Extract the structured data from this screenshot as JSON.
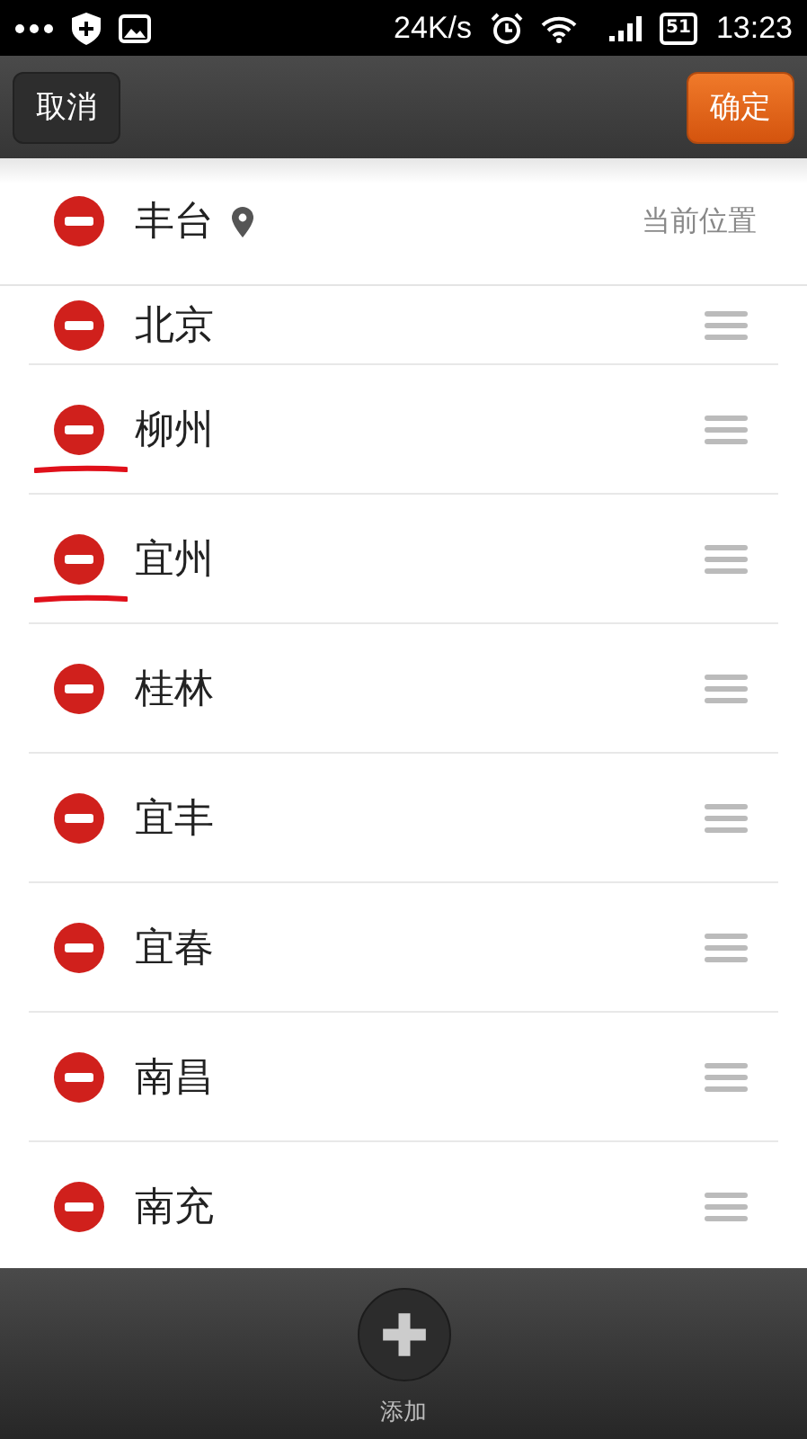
{
  "status_bar": {
    "speed": "24K/s",
    "battery": "51",
    "time": "13:23"
  },
  "header": {
    "cancel": "取消",
    "confirm": "确定"
  },
  "current": {
    "city": "丰台",
    "note": "当前位置"
  },
  "cities": [
    {
      "name": "北京",
      "underlined": false
    },
    {
      "name": "柳州",
      "underlined": true
    },
    {
      "name": "宜州",
      "underlined": true
    },
    {
      "name": "桂林",
      "underlined": false
    },
    {
      "name": "宜丰",
      "underlined": false
    },
    {
      "name": "宜春",
      "underlined": false
    },
    {
      "name": "南昌",
      "underlined": false
    },
    {
      "name": "南充",
      "underlined": false
    }
  ],
  "footer": {
    "add": "添加"
  }
}
